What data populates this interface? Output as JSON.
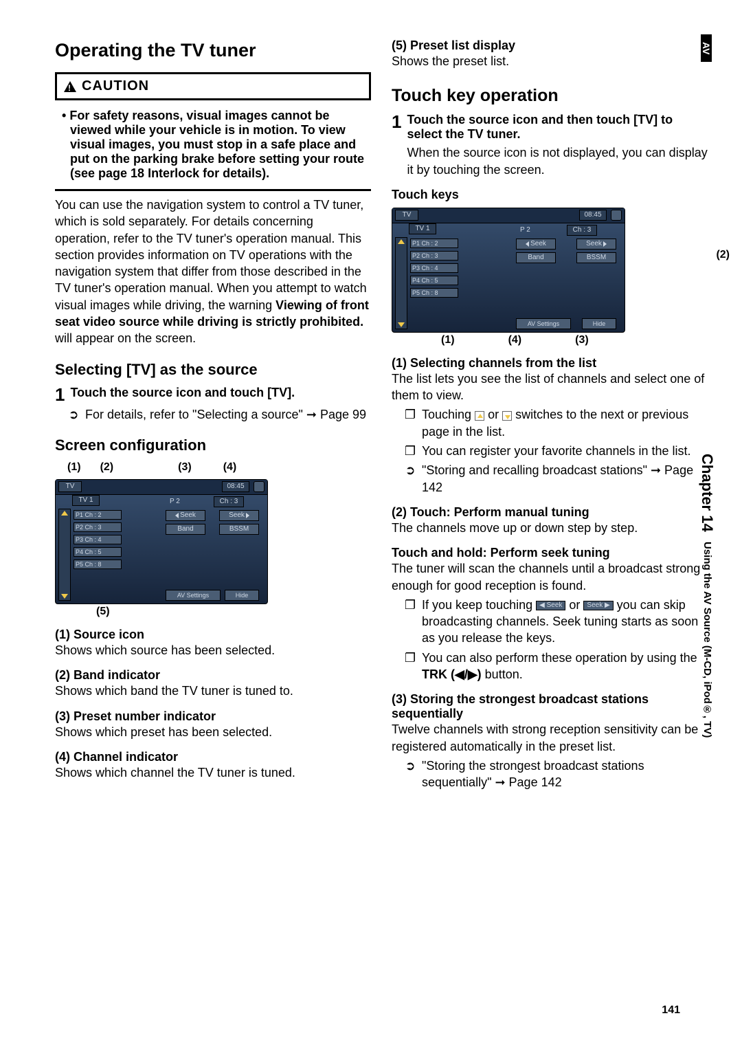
{
  "sidebar": {
    "tab": "AV",
    "chapter": "Chapter 14",
    "section": "Using the AV Source (M-CD, iPod®, TV)"
  },
  "page_number": "141",
  "left": {
    "h1": "Operating the TV tuner",
    "caution_label": "CAUTION",
    "caution_text": "For safety reasons, visual images cannot be viewed while your vehicle is in motion. To view visual images, you must stop in a safe place and put on the parking brake before setting your route (see page 18 Interlock for details).",
    "intro_part1": "You can use the navigation system to control a TV tuner, which is sold separately. For details concerning operation, refer to the TV tuner's operation manual. This section provides information on TV operations with the navigation system that differ from those described in the TV tuner's operation manual. When you attempt to watch visual images while driving, the warning ",
    "intro_bold": "Viewing of front seat video source while driving is strictly prohibited.",
    "intro_part2": " will appear on the screen.",
    "h2": "Selecting [TV] as the source",
    "step1_num": "1",
    "step1_txt": "Touch the source icon and touch [TV].",
    "step1_note_sym": "➲",
    "step1_note": "For details, refer to \"Selecting a source\" ➞ Page 99",
    "h3": "Screen configuration",
    "call_top": [
      "(1)",
      "(2)",
      "(3)",
      "(4)"
    ],
    "call_bot": "(5)",
    "i1_h": "(1) Source icon",
    "i1_d": "Shows which source has been selected.",
    "i2_h": "(2) Band indicator",
    "i2_d": "Shows which band the TV tuner is tuned to.",
    "i3_h": "(3) Preset number indicator",
    "i3_d": "Shows which preset has been selected.",
    "i4_h": "(4) Channel indicator",
    "i4_d": "Shows which channel the TV tuner is tuned."
  },
  "right": {
    "i5_h": "(5) Preset list display",
    "i5_d": "Shows the preset list.",
    "h1": "Touch key operation",
    "step1_num": "1",
    "step1_txt": "Touch the source icon and then touch [TV] to select the TV tuner.",
    "step1_d": "When the source icon is not displayed, you can display it by touching the screen.",
    "touch_keys_h": "Touch keys",
    "call_r2_right": "(2)",
    "call_r2_bot": [
      "(1)",
      "(4)",
      "(3)"
    ],
    "s1_h": "(1) Selecting channels from the list",
    "s1_d": "The list lets you see the list of channels and select one of them to view.",
    "s1_b1a": "Touching ",
    "s1_b1b": " or ",
    "s1_b1c": " switches to the next or previous page in the list.",
    "s1_b2": "You can register your favorite channels in the list.",
    "s1_ref": "\"Storing and recalling broadcast stations\" ➞ Page 142",
    "s2_h": "(2) Touch: Perform manual tuning",
    "s2_d": "The channels move up or down step by step.",
    "s2b_h": "Touch and hold: Perform seek tuning",
    "s2b_d": "The tuner will scan the channels until a broadcast strong enough for good reception is found.",
    "s2_b1a": "If you keep touching ",
    "s2_b1b": " or ",
    "s2_b1c": " you can skip broadcasting channels. Seek tuning starts as soon as you release the keys.",
    "s2_b2a": "You can also perform these operation by using the ",
    "s2_b2b": "TRK (◀/▶)",
    "s2_b2c": " button.",
    "s3_h": "(3) Storing the strongest broadcast stations sequentially",
    "s3_d": "Twelve channels with strong reception sensitivity can be registered automatically in the preset list.",
    "s3_ref": "\"Storing the strongest broadcast stations sequentially\" ➞ Page 142"
  },
  "tv": {
    "src": "TV",
    "band": "TV 1",
    "time": "08:45",
    "preset_num": "P 2",
    "ch": "Ch : 3",
    "p1": "P1   Ch : 2",
    "p2": "P2   Ch : 3",
    "p3": "P3   Ch : 4",
    "p4": "P4   Ch : 5",
    "p5": "P5   Ch : 8",
    "seek": "Seek",
    "band_btn": "Band",
    "bssm": "BSSM",
    "av": "AV Settings",
    "hide": "Hide"
  },
  "sym": {
    "bullet": "❐",
    "ref": "➲",
    "dot": "•"
  }
}
